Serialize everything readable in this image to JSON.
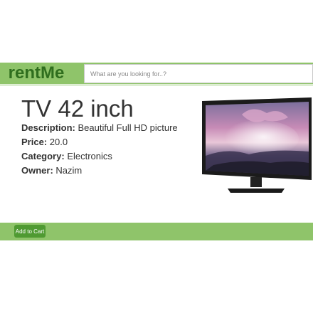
{
  "header": {
    "logo_text": "rentMe",
    "search_placeholder": "What are you looking for..?"
  },
  "product": {
    "title": "TV 42 inch",
    "description_label": "Description:",
    "description": "Beautiful Full HD picture",
    "price_label": "Price:",
    "price": "20.0",
    "category_label": "Category:",
    "category": "Electronics",
    "owner_label": "Owner:",
    "owner": "Nazim",
    "image_icon": "tv-product-image"
  },
  "actions": {
    "add_to_cart_label": "Add to Cart"
  },
  "colors": {
    "accent": "#8fc46a",
    "logo": "#2f6e1e",
    "button": "#4f9a32"
  }
}
